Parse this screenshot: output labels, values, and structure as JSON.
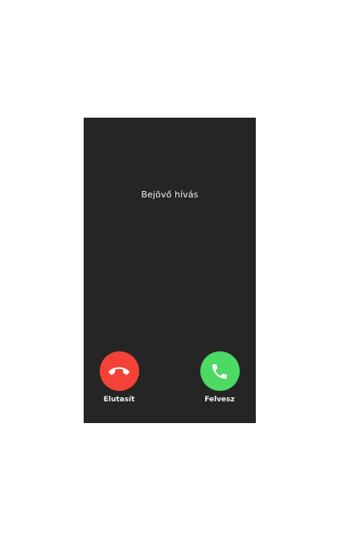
{
  "call": {
    "title": "Bejövő hívás"
  },
  "actions": {
    "decline": {
      "label": "Elutasít",
      "icon": "phone-hangup-icon",
      "color": "#f44336"
    },
    "accept": {
      "label": "Felvesz",
      "icon": "phone-icon",
      "color": "#4cd964"
    }
  },
  "colors": {
    "screen_background": "#252525",
    "page_background": "#ffffff",
    "text": "#f2f2f2"
  }
}
